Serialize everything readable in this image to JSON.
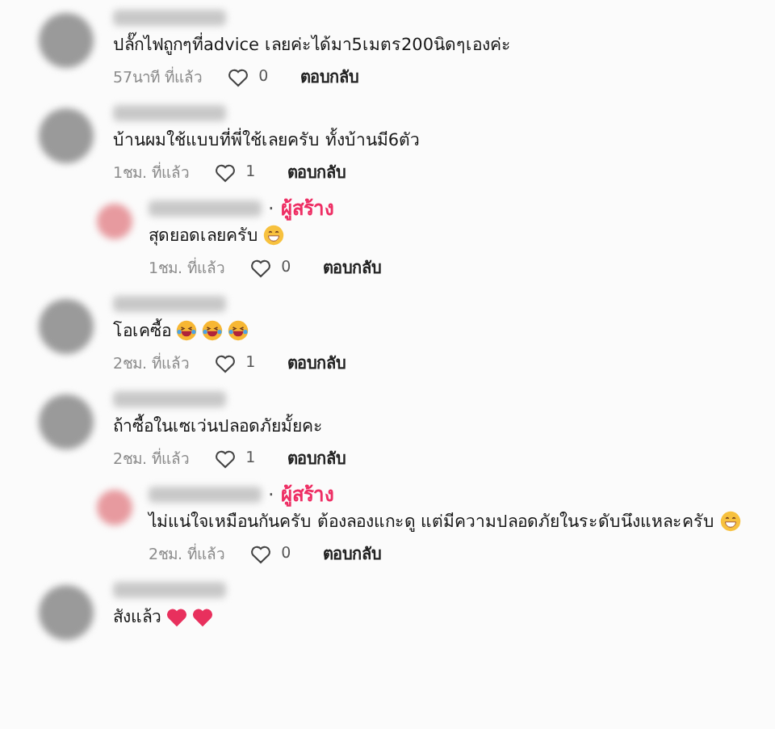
{
  "comments": [
    {
      "text": "ปลั๊กไฟถูกๆที่advice เลยค่ะได้มา5เมตร200นิดๆเองค่ะ",
      "time": "57นาที ที่แล้ว",
      "likes": "0",
      "reply_label": "ตอบกลับ"
    },
    {
      "text": "บ้านผมใช้แบบที่พี่ใช้เลยครับ ทั้งบ้านมี6ตัว",
      "time": "1ชม. ที่แล้ว",
      "likes": "1",
      "reply_label": "ตอบกลับ",
      "replies": [
        {
          "separator": "·",
          "creator_label": "ผู้สร้าง",
          "text": "สุดยอดเลยครับ",
          "emojis": [
            {
              "kind": "grin"
            }
          ],
          "time": "1ชม. ที่แล้ว",
          "likes": "0",
          "reply_label": "ตอบกลับ"
        }
      ]
    },
    {
      "text": "โอเคซื้อ",
      "emojis": [
        {
          "kind": "laugh"
        },
        {
          "kind": "laugh"
        },
        {
          "kind": "laugh"
        }
      ],
      "time": "2ชม. ที่แล้ว",
      "likes": "1",
      "reply_label": "ตอบกลับ"
    },
    {
      "text": "ถ้าซื้อในเซเว่นปลอดภัยมั้ยคะ",
      "time": "2ชม. ที่แล้ว",
      "likes": "1",
      "reply_label": "ตอบกลับ",
      "replies": [
        {
          "separator": "·",
          "creator_label": "ผู้สร้าง",
          "text": "ไม่แน่ใจเหมือนกันครับ ต้องลองแกะดู แต่มีความปลอดภัยในระดับนึงแหละครับ",
          "emojis": [
            {
              "kind": "grin"
            }
          ],
          "time": "2ชม. ที่แล้ว",
          "likes": "0",
          "reply_label": "ตอบกลับ"
        }
      ]
    },
    {
      "text": "สังแล้ว",
      "emojis": [
        {
          "kind": "heart"
        },
        {
          "kind": "heart"
        }
      ]
    }
  ]
}
